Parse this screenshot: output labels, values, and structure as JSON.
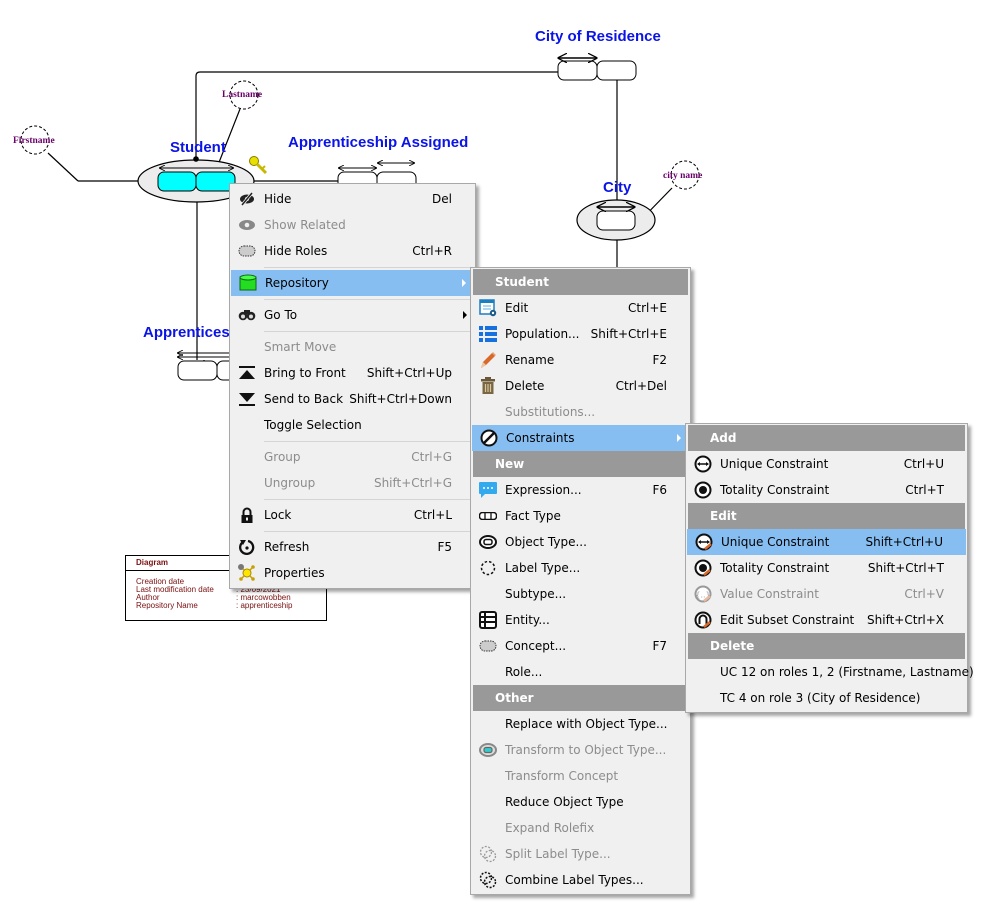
{
  "diagram": {
    "labels": {
      "student": "Student",
      "apprenticeship_assigned": "Apprenticeship Assigned",
      "city_of_residence": "City of Residence",
      "city": "City",
      "apprentices": "Apprentices"
    },
    "value_types": {
      "firstname": "Firstname",
      "lastname": "Lastname",
      "city_name": "city name"
    },
    "info_box": {
      "title": "Diagram",
      "rows": [
        {
          "key": "Creation date",
          "value": ""
        },
        {
          "key": "Last modification date",
          "value": ": 23/09/2021"
        },
        {
          "key": "Author",
          "value": ": marcowobben"
        },
        {
          "key": "Repository Name",
          "value": ": apprenticeship"
        }
      ]
    }
  },
  "context_menu": {
    "items": [
      {
        "label": "Hide",
        "shortcut": "Del",
        "icon": "hide-icon"
      },
      {
        "label": "Show Related",
        "shortcut": "",
        "icon": "eye-icon",
        "disabled": true
      },
      {
        "label": "Hide Roles",
        "shortcut": "Ctrl+R",
        "icon": "dotted-rounded-rect-icon"
      },
      {
        "label": "Repository",
        "shortcut": "",
        "icon": "database-icon",
        "submenu": true,
        "highlighted": true
      },
      {
        "label": "Go To",
        "shortcut": "",
        "icon": "binoculars-icon",
        "submenu": true
      },
      {
        "label": "Smart Move",
        "shortcut": "",
        "disabled": true
      },
      {
        "label": "Bring to Front",
        "shortcut": "Shift+Ctrl+Up",
        "icon": "bring-to-front-icon"
      },
      {
        "label": "Send to Back",
        "shortcut": "Shift+Ctrl+Down",
        "icon": "send-to-back-icon"
      },
      {
        "label": "Toggle Selection",
        "shortcut": ""
      },
      {
        "label": "Group",
        "shortcut": "Ctrl+G",
        "disabled": true
      },
      {
        "label": "Ungroup",
        "shortcut": "Shift+Ctrl+G",
        "disabled": true
      },
      {
        "label": "Lock",
        "shortcut": "Ctrl+L",
        "icon": "lock-icon"
      },
      {
        "label": "Refresh",
        "shortcut": "F5",
        "icon": "refresh-icon"
      },
      {
        "label": "Properties",
        "shortcut": "",
        "icon": "properties-icon"
      }
    ]
  },
  "repository_menu": {
    "header_student": "Student",
    "header_new": "New",
    "header_other": "Other",
    "student_items": [
      {
        "label": "Edit",
        "shortcut": "Ctrl+E"
      },
      {
        "label": "Population...",
        "shortcut": "Shift+Ctrl+E"
      },
      {
        "label": "Rename",
        "shortcut": "F2"
      },
      {
        "label": "Delete",
        "shortcut": "Ctrl+Del"
      },
      {
        "label": "Substitutions...",
        "shortcut": "",
        "disabled": true
      },
      {
        "label": "Constraints",
        "shortcut": "",
        "submenu": true,
        "highlighted": true
      }
    ],
    "new_items": [
      {
        "label": "Expression...",
        "shortcut": "F6"
      },
      {
        "label": "Fact Type",
        "shortcut": ""
      },
      {
        "label": "Object Type...",
        "shortcut": ""
      },
      {
        "label": "Label Type...",
        "shortcut": ""
      },
      {
        "label": "Subtype...",
        "shortcut": ""
      },
      {
        "label": "Entity...",
        "shortcut": ""
      },
      {
        "label": "Concept...",
        "shortcut": "F7"
      },
      {
        "label": "Role...",
        "shortcut": ""
      }
    ],
    "other_items": [
      {
        "label": "Replace with Object Type...",
        "disabled": false
      },
      {
        "label": "Transform to Object Type...",
        "disabled": true
      },
      {
        "label": "Transform Concept",
        "disabled": true
      },
      {
        "label": "Reduce Object Type",
        "disabled": false
      },
      {
        "label": "Expand Rolefix",
        "disabled": true
      },
      {
        "label": "Split Label Type...",
        "disabled": true
      },
      {
        "label": "Combine Label Types...",
        "disabled": false
      }
    ]
  },
  "constraints_menu": {
    "header_add": "Add",
    "header_edit": "Edit",
    "header_delete": "Delete",
    "add_items": [
      {
        "label": "Unique Constraint",
        "shortcut": "Ctrl+U"
      },
      {
        "label": "Totality Constraint",
        "shortcut": "Ctrl+T"
      }
    ],
    "edit_items": [
      {
        "label": "Unique Constraint",
        "shortcut": "Shift+Ctrl+U",
        "highlighted": true
      },
      {
        "label": "Totality Constraint",
        "shortcut": "Shift+Ctrl+T"
      },
      {
        "label": "Value Constraint",
        "shortcut": "Ctrl+V",
        "disabled": true
      },
      {
        "label": "Edit Subset Constraint",
        "shortcut": "Shift+Ctrl+X"
      }
    ],
    "delete_items": [
      {
        "label": "UC 12 on roles 1, 2 (Firstname, Lastname)"
      },
      {
        "label": "TC 4 on role 3 (City of Residence)"
      }
    ]
  },
  "colors": {
    "highlight": "#87bef2",
    "menu_bg": "#f0f0f0",
    "section_header": "#999999",
    "diagram_label": "#0a14e6",
    "value_type_label": "#6a006a",
    "role_fill": "#00ffff"
  }
}
